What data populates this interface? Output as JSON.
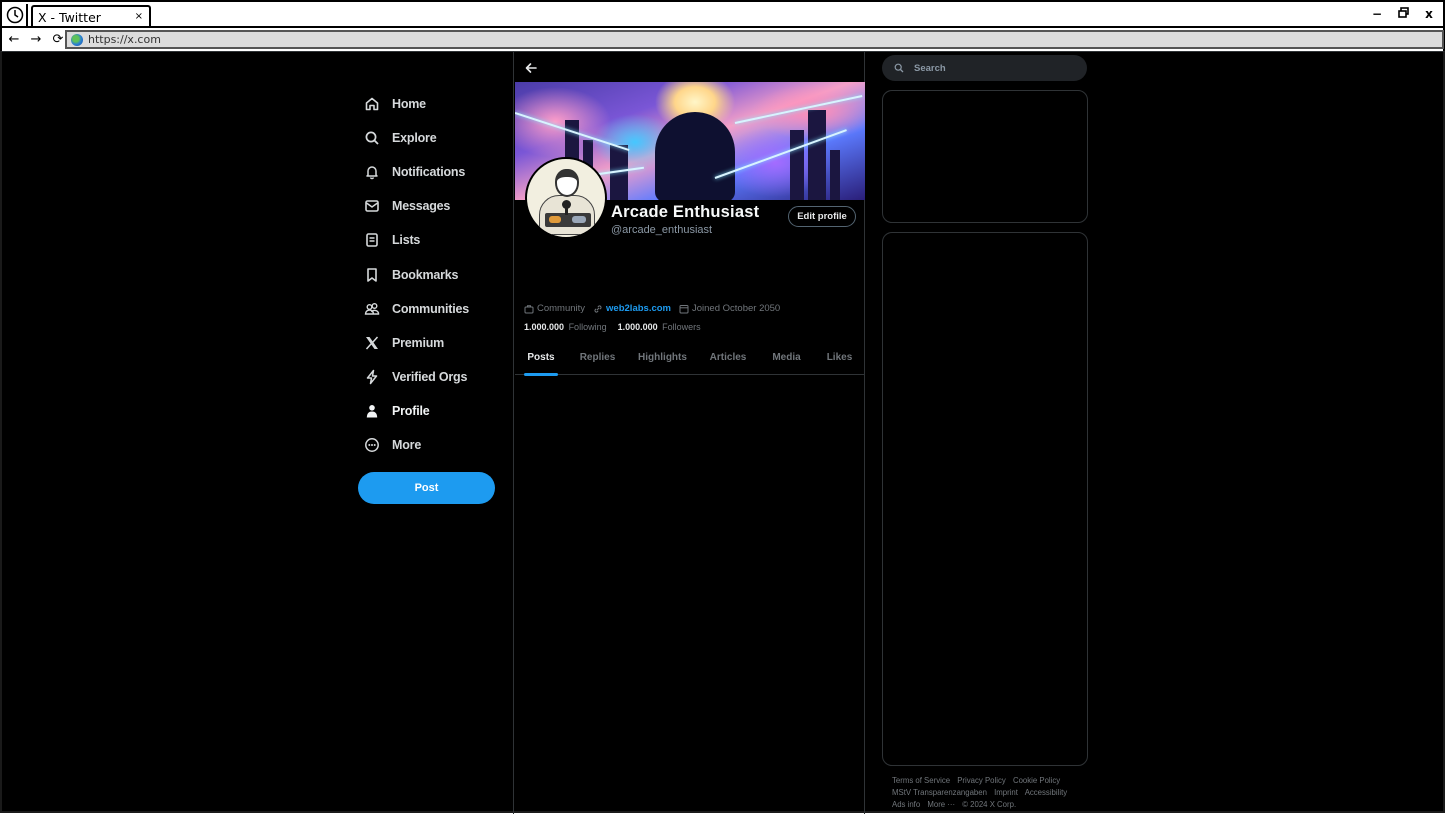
{
  "browser": {
    "tab_title": "X - Twitter",
    "tab_close": "×",
    "url": "https://x.com",
    "nav": {
      "back": "←",
      "forward": "→",
      "reload": "⟳"
    },
    "window_controls": {
      "minimize": "−",
      "restore": "🗗",
      "close": "x"
    }
  },
  "sidebar": {
    "items": [
      {
        "label": "Home",
        "icon": "home-icon"
      },
      {
        "label": "Explore",
        "icon": "search-icon"
      },
      {
        "label": "Notifications",
        "icon": "bell-icon"
      },
      {
        "label": "Messages",
        "icon": "mail-icon"
      },
      {
        "label": "Lists",
        "icon": "list-icon"
      },
      {
        "label": "Bookmarks",
        "icon": "bookmark-icon"
      },
      {
        "label": "Communities",
        "icon": "communities-icon"
      },
      {
        "label": "Premium",
        "icon": "x-logo-icon"
      },
      {
        "label": "Verified Orgs",
        "icon": "lightning-icon"
      },
      {
        "label": "Profile",
        "icon": "person-icon",
        "active": true
      },
      {
        "label": "More",
        "icon": "more-circle-icon"
      }
    ],
    "post_label": "Post"
  },
  "profile": {
    "display_name": "Arcade Enthusiast",
    "handle": "@arcade_enthusiast",
    "edit_profile_label": "Edit profile",
    "category": "Community",
    "website": "web2labs.com",
    "joined": "Joined October 2050",
    "following_count": "1.000.000",
    "following_label": "Following",
    "followers_count": "1.000.000",
    "followers_label": "Followers",
    "tabs": [
      {
        "label": "Posts",
        "active": true
      },
      {
        "label": "Replies"
      },
      {
        "label": "Highlights"
      },
      {
        "label": "Articles"
      },
      {
        "label": "Media"
      },
      {
        "label": "Likes"
      }
    ]
  },
  "right": {
    "search_placeholder": "Search",
    "footer_links": [
      "Terms of Service",
      "Privacy Policy",
      "Cookie Policy",
      "MStV Transparenzangaben",
      "Imprint",
      "Accessibility",
      "Ads info",
      "More ···",
      "© 2024 X Corp."
    ]
  },
  "colors": {
    "accent": "#1d9bf0",
    "background": "#000000",
    "border": "#2f3336",
    "muted_text": "#71767b"
  }
}
